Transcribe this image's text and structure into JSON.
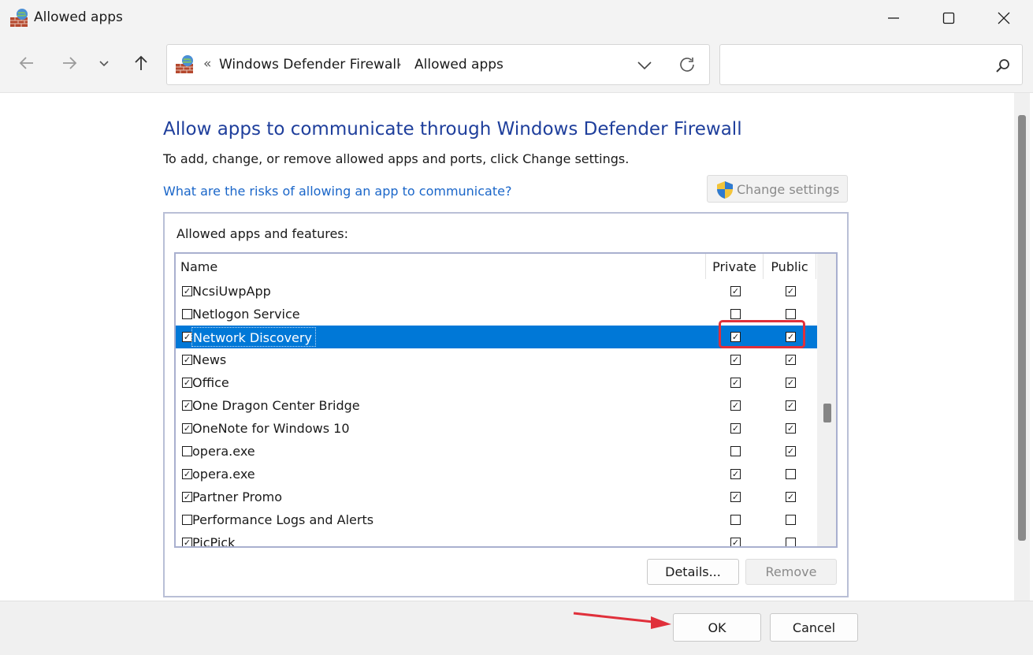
{
  "window": {
    "title": "Allowed apps"
  },
  "address_bar": {
    "overflow_chevron": "«",
    "crumbs": [
      "Windows Defender Firewall",
      "Allowed apps"
    ],
    "separator": "›"
  },
  "search": {
    "placeholder": ""
  },
  "content": {
    "heading": "Allow apps to communicate through Windows Defender Firewall",
    "subtext": "To add, change, or remove allowed apps and ports, click Change settings.",
    "risk_link": "What are the risks of allowing an app to communicate?",
    "change_settings_label": "Change settings",
    "group_label": "Allowed apps and features:"
  },
  "list": {
    "columns": {
      "name": "Name",
      "private": "Private",
      "public": "Public"
    },
    "rows": [
      {
        "name": "NcsiUwpApp",
        "enabled": true,
        "private": true,
        "public": true,
        "selected": false
      },
      {
        "name": "Netlogon Service",
        "enabled": false,
        "private": false,
        "public": false,
        "selected": false
      },
      {
        "name": "Network Discovery",
        "enabled": true,
        "private": true,
        "public": true,
        "selected": true
      },
      {
        "name": "News",
        "enabled": true,
        "private": true,
        "public": true,
        "selected": false
      },
      {
        "name": "Office",
        "enabled": true,
        "private": true,
        "public": true,
        "selected": false
      },
      {
        "name": "One Dragon Center Bridge",
        "enabled": true,
        "private": true,
        "public": true,
        "selected": false
      },
      {
        "name": "OneNote for Windows 10",
        "enabled": true,
        "private": true,
        "public": true,
        "selected": false
      },
      {
        "name": "opera.exe",
        "enabled": false,
        "private": false,
        "public": true,
        "selected": false
      },
      {
        "name": "opera.exe",
        "enabled": true,
        "private": true,
        "public": false,
        "selected": false
      },
      {
        "name": "Partner Promo",
        "enabled": true,
        "private": true,
        "public": true,
        "selected": false
      },
      {
        "name": "Performance Logs and Alerts",
        "enabled": false,
        "private": false,
        "public": false,
        "selected": false
      },
      {
        "name": "PicPick",
        "enabled": true,
        "private": true,
        "public": false,
        "selected": false
      }
    ]
  },
  "buttons": {
    "details": "Details...",
    "remove": "Remove",
    "ok": "OK",
    "cancel": "Cancel"
  },
  "colors": {
    "heading": "#1f3f9c",
    "link": "#1a66c9",
    "selection": "#0078d7",
    "annotation": "#e0303b"
  },
  "icons": {
    "app": "firewall-icon",
    "shield": "uac-shield-icon"
  }
}
